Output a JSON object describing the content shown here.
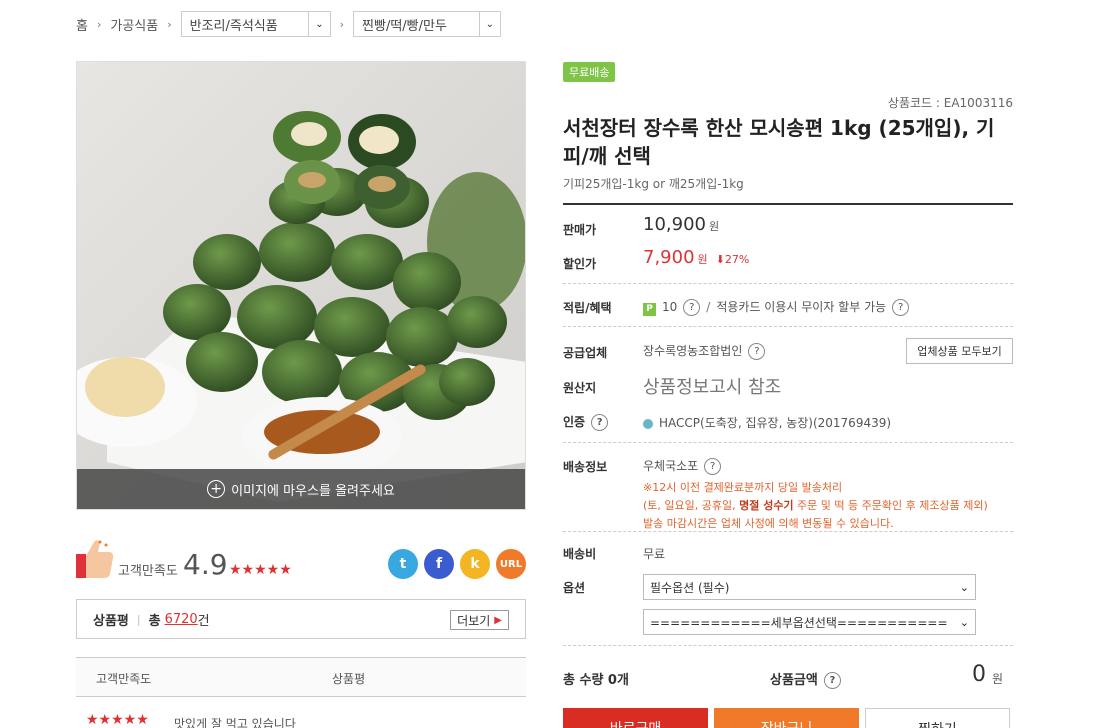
{
  "breadcrumb": {
    "home": "홈",
    "level1": "가공식품",
    "level2": "반조리/즉석식품",
    "level3": "찐빵/떡/빵/만두"
  },
  "image": {
    "hover_hint": "이미지에 마우스를 올려주세요"
  },
  "satisfaction": {
    "label": "고객만족도",
    "score": "4.9",
    "stars": "★★★★★"
  },
  "share": {
    "twitter_glyph": "t",
    "facebook_glyph": "f",
    "kakao_glyph": "k",
    "url_label": "URL"
  },
  "reviews": {
    "title": "상품평",
    "total_prefix": "총",
    "count": "6720",
    "count_suffix": "건",
    "more_label": "더보기",
    "col_satisfaction": "고객만족도",
    "col_review": "상품평",
    "first_row_stars": "★★★★★",
    "first_row_text": "맛있게 잘 먹고 있습니다"
  },
  "product": {
    "badge": "무료배송",
    "code_label": "상품코드 : EA1003116",
    "title": "서천장터 장수록 한산 모시송편 1kg (25개입), 기피/깨 선택",
    "subtitle": "기피25개입-1kg or 깨25개입-1kg"
  },
  "pricing": {
    "sale_price_label": "판매가",
    "sale_price": "10,900",
    "currency": "원",
    "discount_label": "할인가",
    "discount_price": "7,900",
    "discount_rate": "⬇27%"
  },
  "benefit": {
    "label": "적립/혜택",
    "point_icon": "P",
    "points": "10",
    "card_text": "적용카드 이용시 무이자 할부 가능"
  },
  "vendor": {
    "label": "공급업체",
    "name": "장수록영농조합법인",
    "all_products_button": "업체상품 모두보기"
  },
  "origin": {
    "label": "원산지",
    "value": "상품정보고시 참조"
  },
  "certification": {
    "label": "인증",
    "value": "HACCP(도축장, 집유장, 농장)(201769439)"
  },
  "shipping": {
    "label": "배송정보",
    "method": "우체국소포",
    "note1": "※12시 이전 결제완료분까지 당일 발송처리",
    "note2_a": "(토, 일요일, 공휴일, ",
    "note2_b": "명절 성수기",
    "note2_c": " 주문 및 떡 등 주문확인 후 제조상품 제외)",
    "note3": "발송 마감시간은 업체 사정에 의해 변동될 수 있습니다."
  },
  "shipping_fee": {
    "label": "배송비",
    "value": "무료"
  },
  "options": {
    "label": "옵션",
    "required": "필수옵션 (필수)",
    "detail": "============세부옵션선택==========="
  },
  "totals": {
    "quantity_label": "총 수량 0개",
    "amount_label": "상품금액",
    "amount": "0",
    "currency": "원"
  },
  "actions": {
    "buy": "바로구매",
    "cart": "장바구니",
    "wish": "찜하기"
  },
  "icons": {
    "question": "?",
    "plus": "+",
    "chevron_down": "⌄",
    "chevron_right": "›",
    "arrow_right": "▶"
  },
  "colors": {
    "accent_red": "#d92d24",
    "accent_orange": "#f07a2a",
    "badge_green": "#7ec447"
  }
}
